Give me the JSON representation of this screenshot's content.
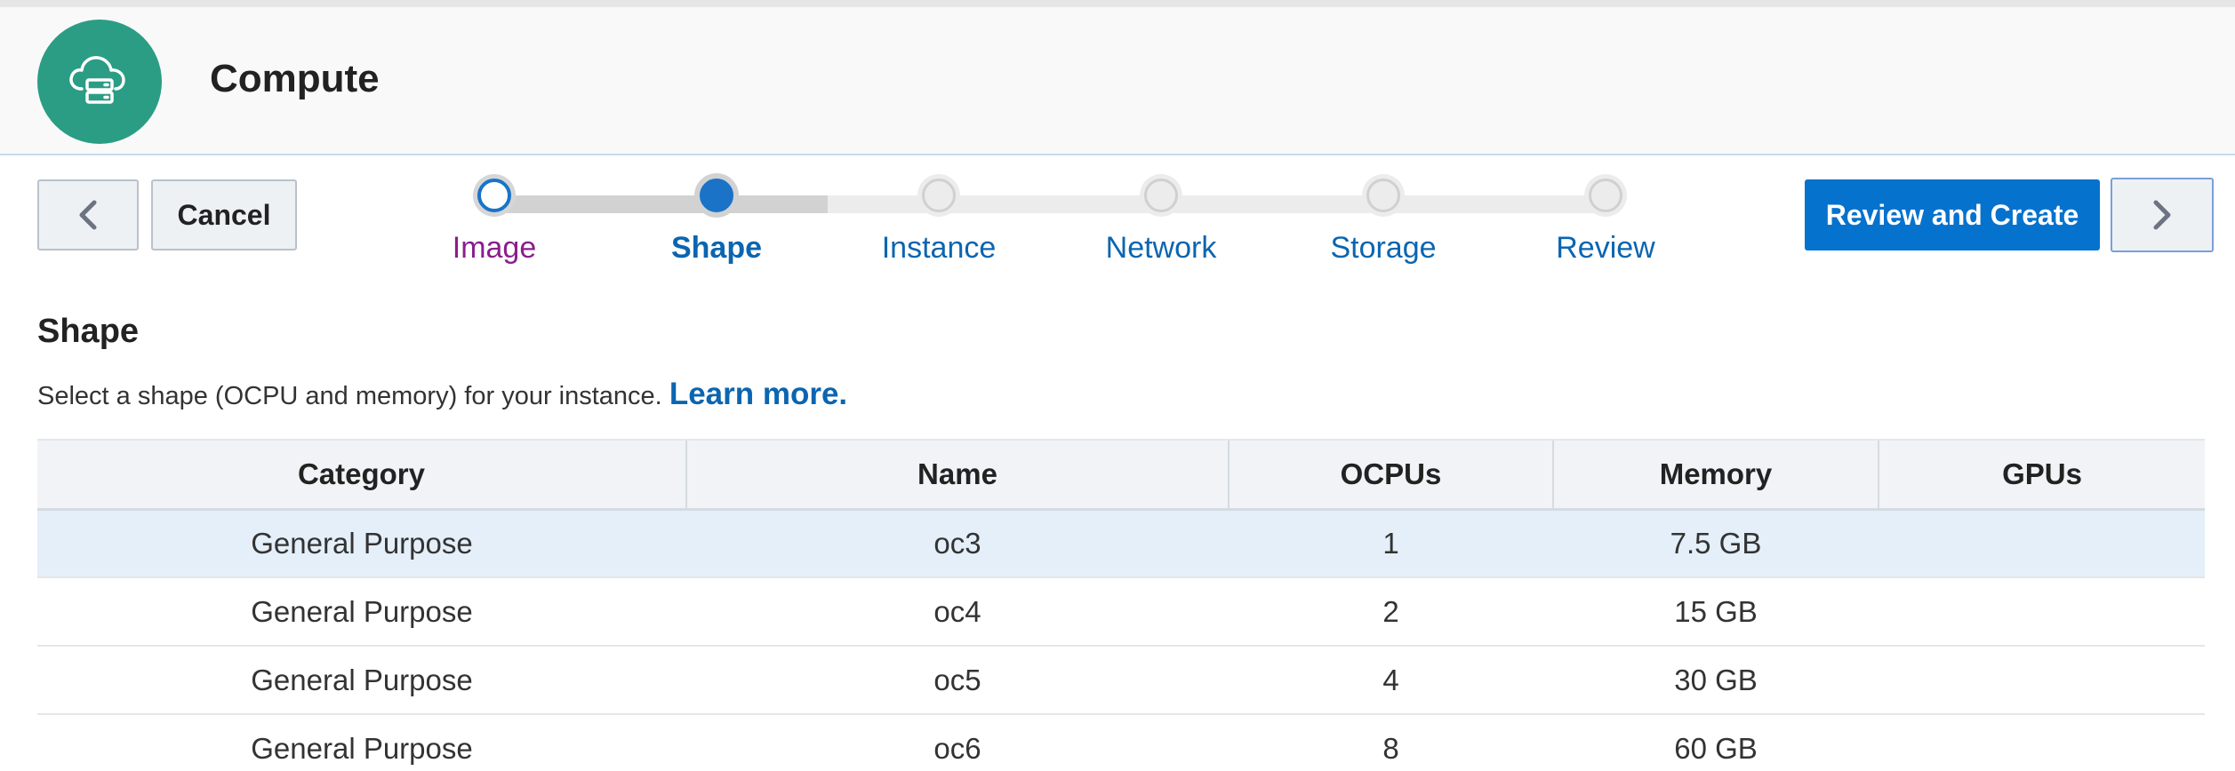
{
  "header": {
    "title": "Compute",
    "icon": "cloud-server-icon",
    "icon_bg": "#2b9d84"
  },
  "toolbar": {
    "back_icon": "chevron-left-icon",
    "cancel_label": "Cancel",
    "review_create_label": "Review and Create",
    "next_icon": "chevron-right-icon",
    "primary_color": "#0572ce"
  },
  "train": {
    "steps": [
      {
        "label": "Image",
        "state": "visited"
      },
      {
        "label": "Shape",
        "state": "current"
      },
      {
        "label": "Instance",
        "state": "future"
      },
      {
        "label": "Network",
        "state": "future"
      },
      {
        "label": "Storage",
        "state": "future"
      },
      {
        "label": "Review",
        "state": "future"
      }
    ]
  },
  "section": {
    "title": "Shape",
    "description": "Select a shape (OCPU and memory) for your instance.",
    "learn_more": "Learn more."
  },
  "table": {
    "columns": [
      "Category",
      "Name",
      "OCPUs",
      "Memory",
      "GPUs"
    ],
    "rows": [
      {
        "category": "General Purpose",
        "name": "oc3",
        "ocpus": "1",
        "memory": "7.5 GB",
        "gpus": "",
        "selected": true
      },
      {
        "category": "General Purpose",
        "name": "oc4",
        "ocpus": "2",
        "memory": "15 GB",
        "gpus": "",
        "selected": false
      },
      {
        "category": "General Purpose",
        "name": "oc5",
        "ocpus": "4",
        "memory": "30 GB",
        "gpus": "",
        "selected": false
      },
      {
        "category": "General Purpose",
        "name": "oc6",
        "ocpus": "8",
        "memory": "60 GB",
        "gpus": "",
        "selected": false
      }
    ]
  }
}
